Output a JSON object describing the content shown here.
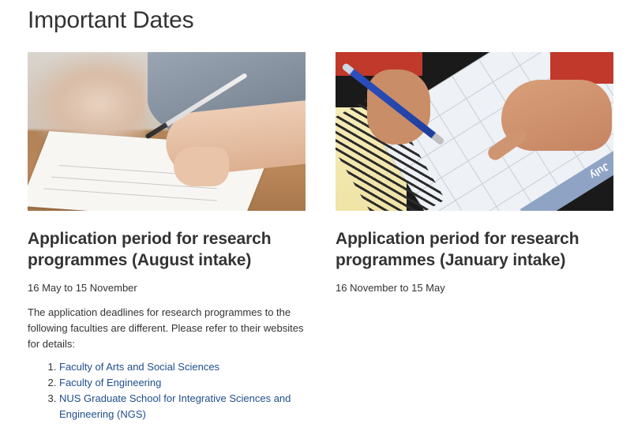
{
  "page": {
    "title": "Important Dates"
  },
  "cards": [
    {
      "image_alt": "Hands writing on paper with a pen",
      "title": "Application period for research programmes (August intake)",
      "period": "16 May to 15 November",
      "description": "The application deadlines for research programmes to the following faculties are different. Please refer to their websites for details:",
      "links": [
        {
          "label": "Faculty of Arts and Social Sciences"
        },
        {
          "label": "Faculty of Engineering"
        },
        {
          "label": "NUS Graduate School for Integrative Sciences and Engineering (NGS)"
        }
      ]
    },
    {
      "image_alt": "Hands marking dates on a planner calendar",
      "calendar_month_label": "July",
      "title": "Application period for research programmes (January intake)",
      "period": "16 November to 15 May"
    }
  ],
  "colors": {
    "text": "#333333",
    "link": "#1f4e8c"
  }
}
